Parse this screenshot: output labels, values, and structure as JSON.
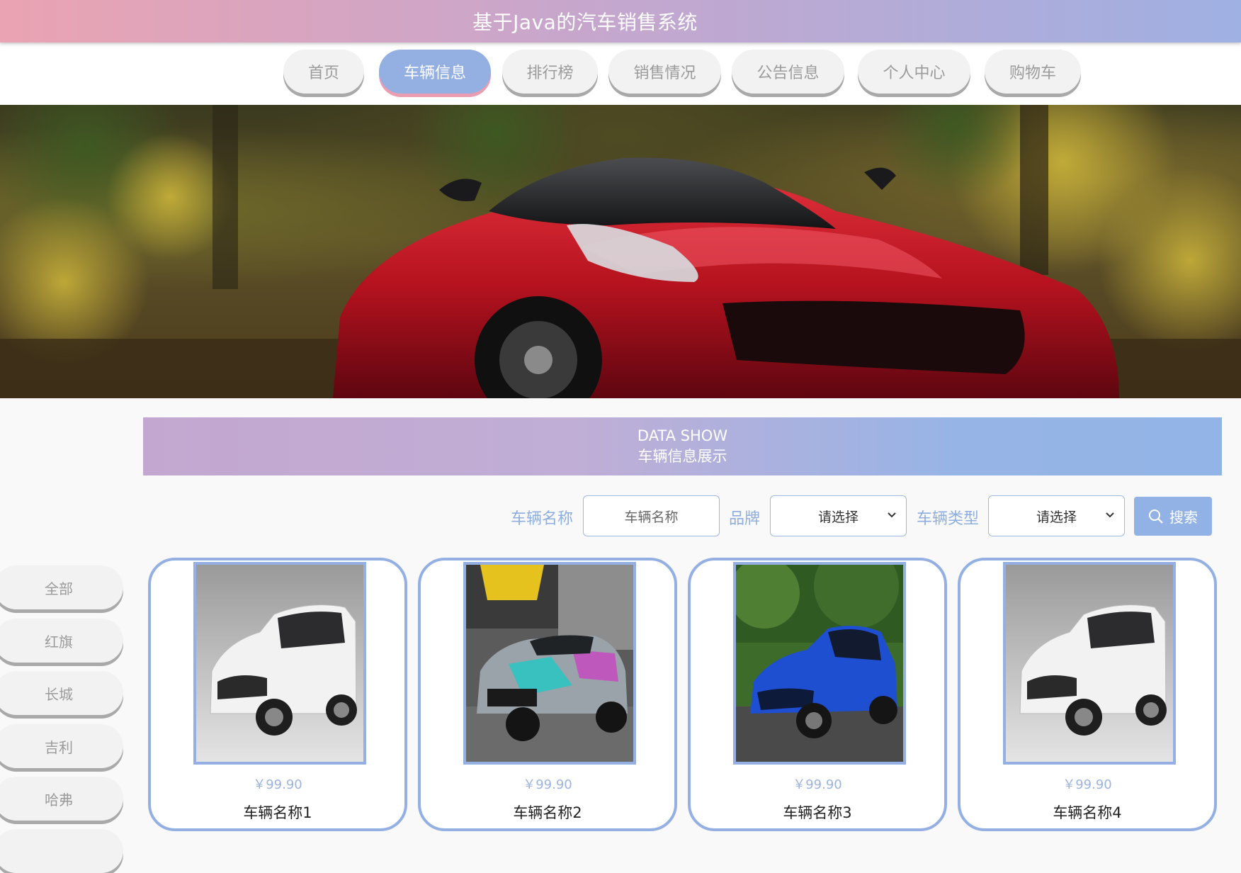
{
  "header": {
    "title": "基于Java的汽车销售系统"
  },
  "nav": {
    "items": [
      {
        "label": "首页"
      },
      {
        "label": "车辆信息",
        "active": true
      },
      {
        "label": "排行榜"
      },
      {
        "label": "销售情况"
      },
      {
        "label": "公告信息"
      },
      {
        "label": "个人中心"
      },
      {
        "label": "购物车"
      }
    ]
  },
  "section": {
    "en": "DATA SHOW",
    "cn": "车辆信息展示"
  },
  "search": {
    "name_label": "车辆名称",
    "name_placeholder": "车辆名称",
    "brand_label": "品牌",
    "brand_value": "请选择",
    "type_label": "车辆类型",
    "type_value": "请选择",
    "button_label": "搜索"
  },
  "sidebar": {
    "items": [
      {
        "label": "全部"
      },
      {
        "label": "红旗"
      },
      {
        "label": "长城"
      },
      {
        "label": "吉利"
      },
      {
        "label": "哈弗"
      }
    ]
  },
  "cards": [
    {
      "price": "￥99.90",
      "name": "车辆名称1",
      "image": "white-mpv"
    },
    {
      "price": "￥99.90",
      "name": "车辆名称2",
      "image": "hks-hatchback"
    },
    {
      "price": "￥99.90",
      "name": "车辆名称3",
      "image": "blue-coupe"
    },
    {
      "price": "￥99.90",
      "name": "车辆名称4",
      "image": "white-mpv"
    }
  ],
  "colors": {
    "accent": "#94b0e3",
    "accent_pink": "#eaa3b2",
    "label_blue": "#8eaee0",
    "price_blue": "#9db4e0"
  }
}
